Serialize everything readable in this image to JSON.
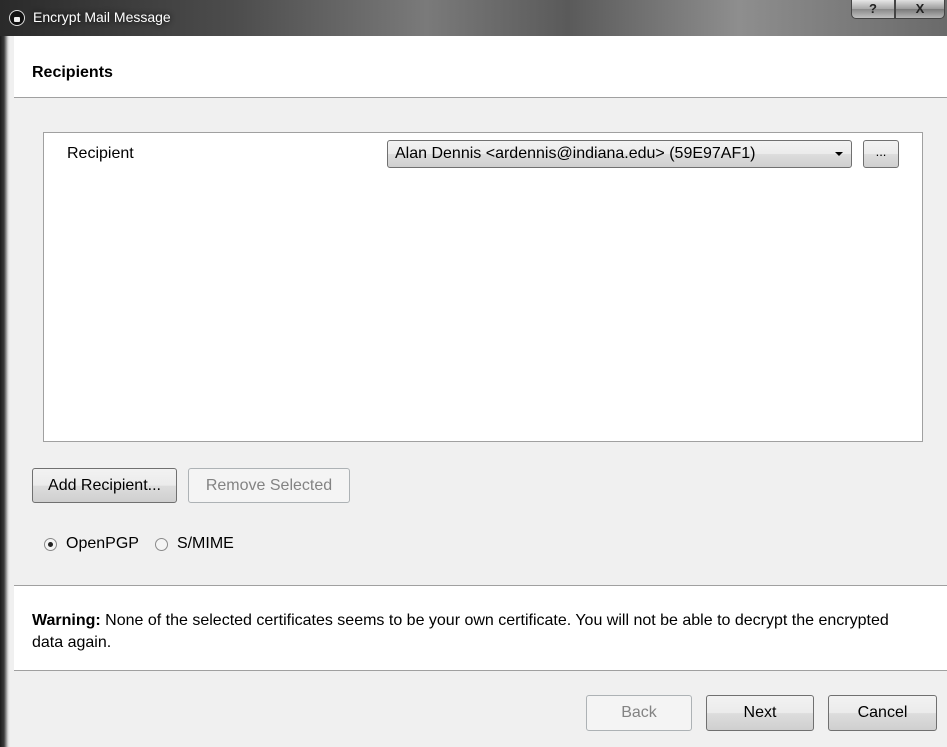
{
  "window": {
    "title": "Encrypt Mail Message",
    "help_label": "?",
    "close_label": "X"
  },
  "header": {
    "title": "Recipients"
  },
  "recipients": {
    "label": "Recipient",
    "selected_value": "Alan Dennis <ardennis@indiana.edu> (59E97AF1)",
    "browse_label": "..."
  },
  "actions": {
    "add_label": "Add Recipient...",
    "remove_label": "Remove Selected"
  },
  "protocol": {
    "options": [
      "OpenPGP",
      "S/MIME"
    ],
    "selected": "OpenPGP"
  },
  "warning": {
    "prefix": "Warning:",
    "text": " None of the selected certificates seems to be your own certificate. You will not be able to decrypt the encrypted data again."
  },
  "footer": {
    "back_label": "Back",
    "next_label": "Next",
    "cancel_label": "Cancel"
  }
}
